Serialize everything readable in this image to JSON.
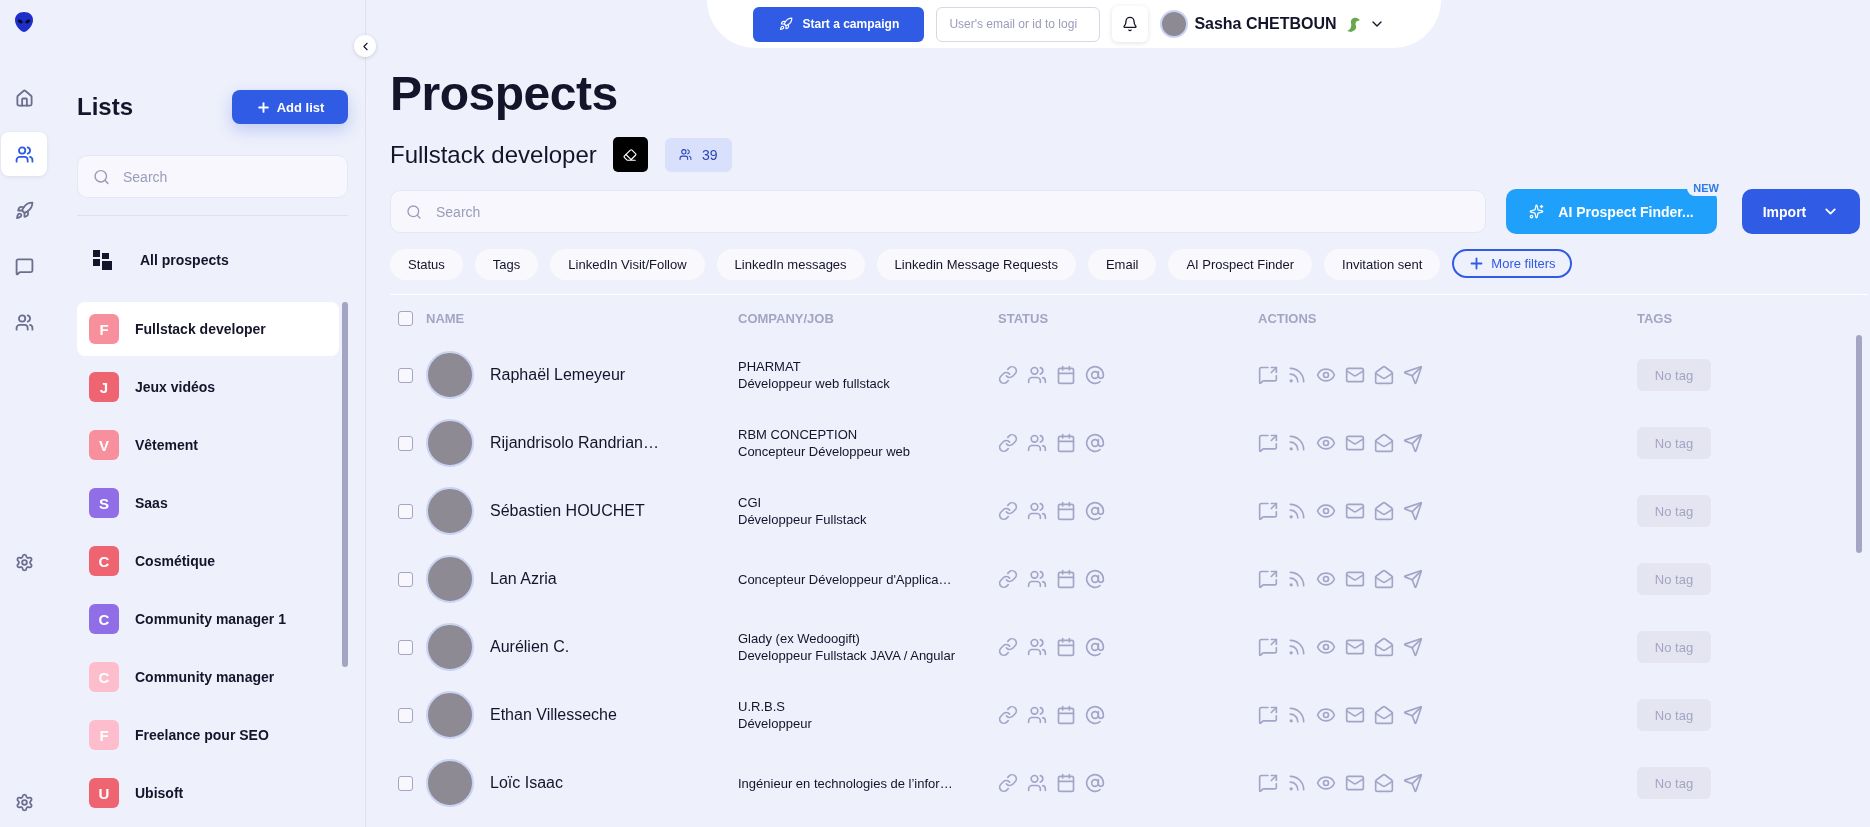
{
  "rail": [
    {
      "kind": "home",
      "selected": false
    },
    {
      "kind": "users",
      "selected": true
    },
    {
      "kind": "rocket",
      "selected": false
    },
    {
      "kind": "chat",
      "selected": false
    },
    {
      "kind": "team",
      "selected": false
    },
    {
      "kind": "settings",
      "selected": false
    },
    {
      "kind": "settings",
      "selected": false
    }
  ],
  "lists_panel": {
    "title": "Lists",
    "add_button": "Add list",
    "search": {
      "placeholder": "Search"
    },
    "all_prospects": "All prospects",
    "items": [
      {
        "letter": "F",
        "name": "Fullstack developer",
        "color": "#f78f9c",
        "selected": true
      },
      {
        "letter": "J",
        "name": "Jeux vidéos",
        "color": "#ee6470",
        "selected": false
      },
      {
        "letter": "V",
        "name": "Vêtement",
        "color": "#f78f9c",
        "selected": false
      },
      {
        "letter": "S",
        "name": "Saas",
        "color": "#8f6ee8",
        "selected": false
      },
      {
        "letter": "C",
        "name": "Cosmétique",
        "color": "#ee6470",
        "selected": false
      },
      {
        "letter": "C",
        "name": "Community manager 1",
        "color": "#8f6ee8",
        "selected": false
      },
      {
        "letter": "C",
        "name": "Community manager",
        "color": "#fdbdcc",
        "selected": false
      },
      {
        "letter": "F",
        "name": "Freelance pour SEO",
        "color": "#fdbdcc",
        "selected": false
      },
      {
        "letter": "U",
        "name": "Ubisoft",
        "color": "#ee6470",
        "selected": false
      }
    ]
  },
  "top_bar": {
    "campaign_button": "Start a campaign",
    "login_field": {
      "placeholder": "User's email or id to logi"
    },
    "user_name": "Sasha CHETBOUN"
  },
  "header": {
    "title": "Prospects",
    "list_name": "Fullstack developer",
    "count": "39"
  },
  "search": {
    "placeholder": "Search"
  },
  "ai_button": "AI Prospect Finder...",
  "ai_badge": "NEW",
  "import_button": "Import",
  "filters": [
    "Status",
    "Tags",
    "LinkedIn Visit/Follow",
    "LinkedIn messages",
    "Linkedin Message Requests",
    "Email",
    "AI Prospect Finder",
    "Invitation sent"
  ],
  "more_filters": "More filters",
  "table": {
    "select_all_checked": false,
    "columns": [
      "NAME",
      "COMPANY/JOB",
      "STATUS",
      "ACTIONS",
      "TAGS"
    ],
    "rows": [
      {
        "checked": false,
        "name": "Raphaël Lemeyeur",
        "company": "PHARMAT",
        "job": "Développeur web fullstack",
        "tag": "No tag"
      },
      {
        "checked": false,
        "name": "Rijandrisolo Randrian…",
        "company": "RBM CONCEPTION",
        "job": "Concepteur Développeur web",
        "tag": "No tag"
      },
      {
        "checked": false,
        "name": "Sébastien HOUCHET",
        "company": "CGI",
        "job": "Développeur Fullstack",
        "tag": "No tag"
      },
      {
        "checked": false,
        "name": "Lan Azria",
        "job": "Concepteur Développeur d'Applica…",
        "tag": "No tag"
      },
      {
        "checked": false,
        "name": "Aurélien C.",
        "company": "Glady (ex Wedoogift)",
        "job": "Developpeur Fullstack JAVA / Angular",
        "tag": "No tag"
      },
      {
        "checked": false,
        "name": "Ethan Villesseche",
        "company": "U.R.B.S",
        "job": "Développeur",
        "tag": "No tag"
      },
      {
        "checked": false,
        "name": "Loïc Isaac",
        "job": "Ingénieur en technologies de l’infor…",
        "tag": "No tag"
      }
    ]
  }
}
